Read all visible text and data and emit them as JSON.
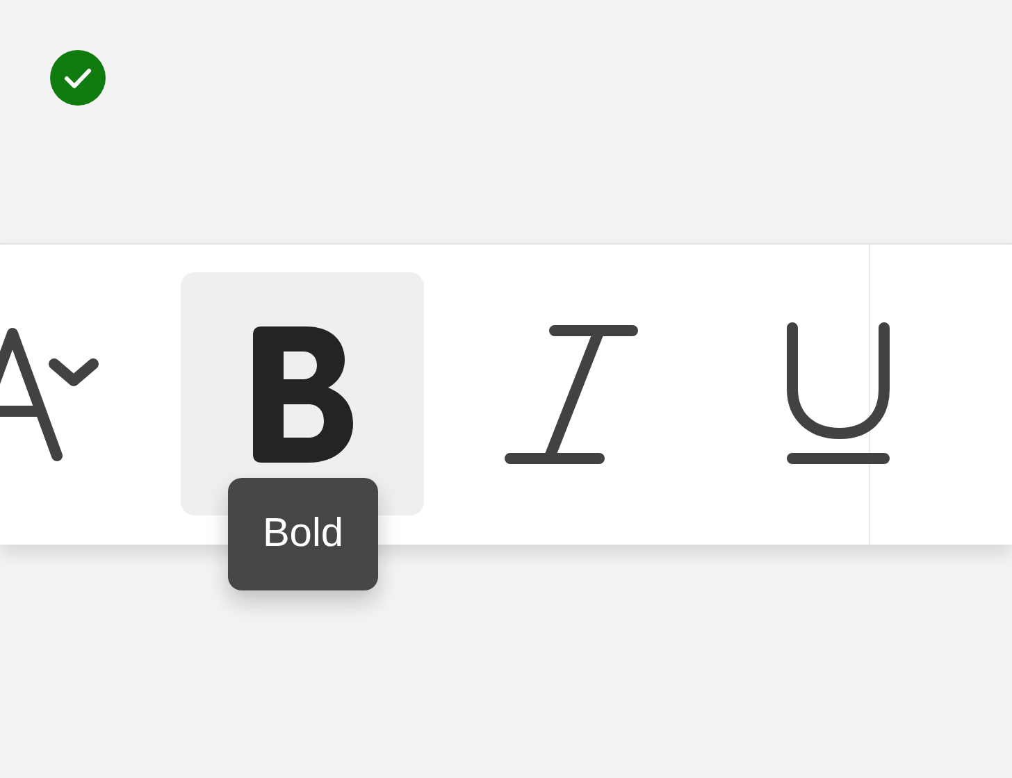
{
  "status": {
    "kind": "success"
  },
  "toolbar": {
    "buttons": [
      {
        "kind": "font-size",
        "selected": false
      },
      {
        "kind": "bold",
        "selected": true
      },
      {
        "kind": "italic",
        "selected": false
      },
      {
        "kind": "underline",
        "selected": false
      }
    ]
  },
  "tooltip": {
    "text": "Bold"
  }
}
